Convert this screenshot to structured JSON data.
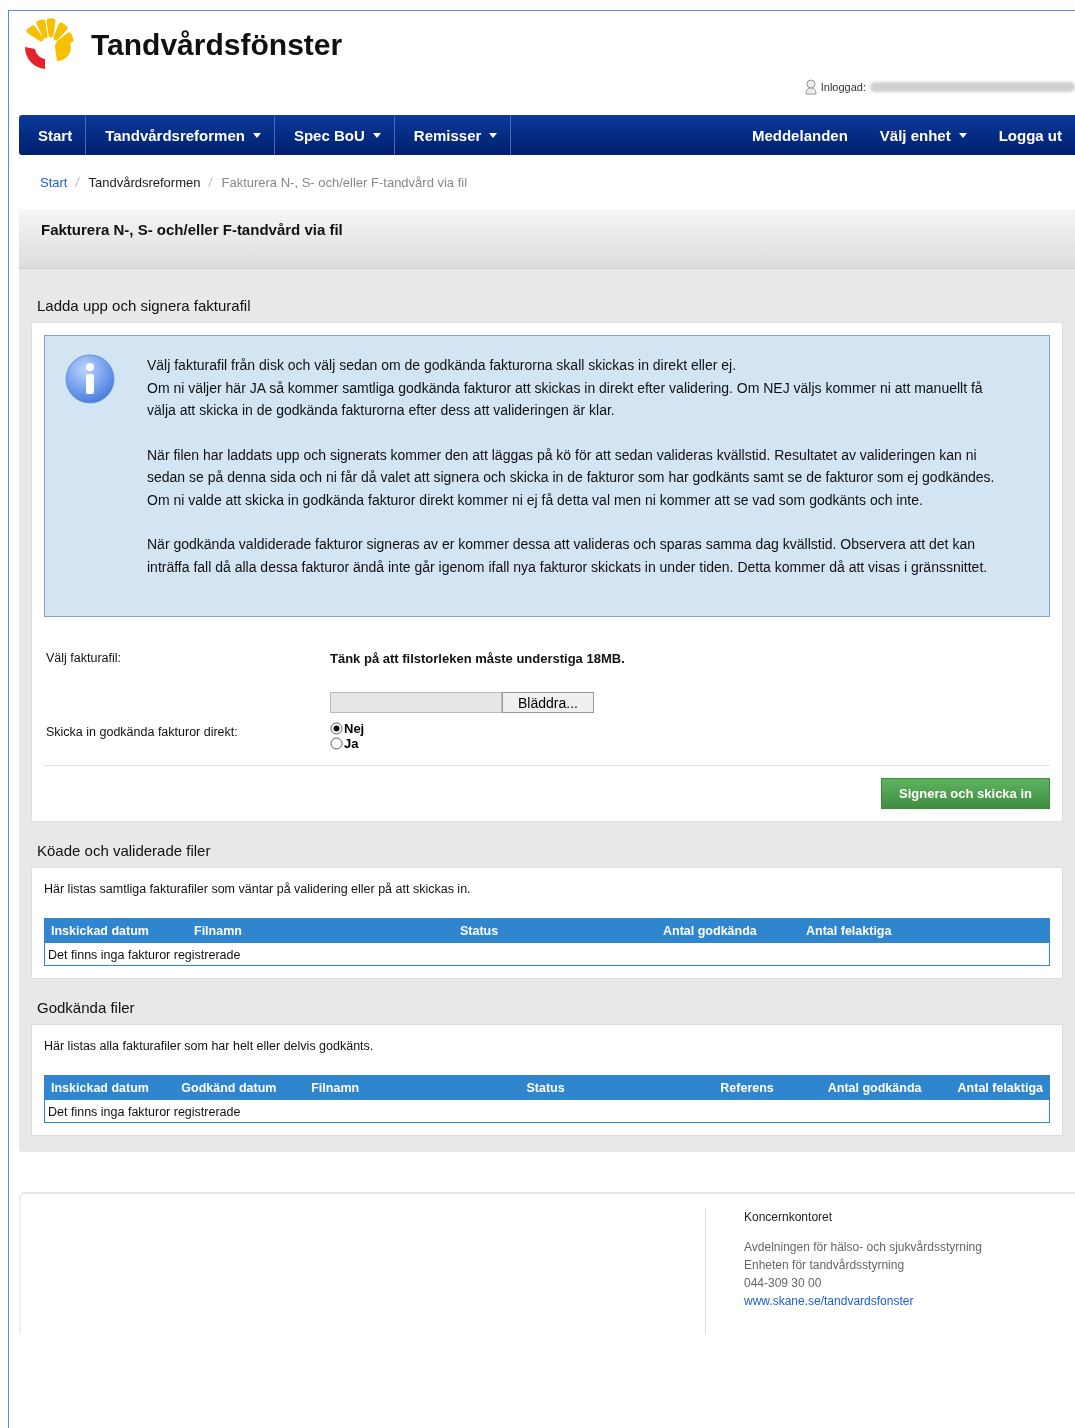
{
  "header": {
    "title": "Tandvårdsfönster",
    "logged_in_label": "Inloggad:"
  },
  "nav": {
    "left": [
      {
        "label": "Start",
        "dropdown": false
      },
      {
        "label": "Tandvårdsreformen",
        "dropdown": true
      },
      {
        "label": "Spec BoU",
        "dropdown": true
      },
      {
        "label": "Remisser",
        "dropdown": true
      }
    ],
    "right": [
      {
        "label": "Meddelanden",
        "dropdown": false
      },
      {
        "label": "Välj enhet",
        "dropdown": true
      },
      {
        "label": "Logga ut",
        "dropdown": false
      }
    ]
  },
  "breadcrumb": [
    {
      "label": "Start",
      "kind": "link"
    },
    {
      "label": "Tandvårdsreformen",
      "kind": "item"
    },
    {
      "label": "Fakturera N-, S- och/eller F-tandvård via fil",
      "kind": "current"
    }
  ],
  "page_title": "Fakturera N-, S- och/eller F-tandvård via fil",
  "upload": {
    "heading": "Ladda upp och signera fakturafil",
    "info": [
      "Välj fakturafil från disk och välj sedan om de godkända fakturorna skall skickas in direkt eller ej.\nOm ni väljer här JA så kommer samtliga godkända fakturor att skickas in direkt efter validering. Om NEJ väljs kommer ni att manuellt få välja att skicka in de godkända fakturorna efter dess att valideringen är klar.",
      "När filen har laddats upp och signerats kommer den att läggas på kö för att sedan valideras kvällstid. Resultatet av valideringen kan ni sedan se på denna sida och ni får då valet att signera och skicka in de fakturor som har godkänts samt se de fakturor som ej godkändes. Om ni valde att skicka in godkända fakturor direkt kommer ni ej få detta val men ni kommer att se vad som godkänts och inte.",
      "När godkända valdiderade fakturor signeras av er kommer dessa att valideras och sparas samma dag kvällstid. Observera att det kan inträffa fall då alla dessa fakturor ändå inte går igenom ifall nya fakturor skickats in under tiden. Detta kommer då att visas i gränssnittet."
    ],
    "file_label": "Välj fakturafil:",
    "file_note": "Tänk på att filstorleken måste understiga 18MB.",
    "browse_button": "Bläddra...",
    "direct_label": "Skicka in godkända fakturor direkt:",
    "options": [
      {
        "label": "Nej",
        "selected": true
      },
      {
        "label": "Ja",
        "selected": false
      }
    ],
    "submit_button": "Signera och skicka in"
  },
  "queued": {
    "heading": "Köade och validerade filer",
    "description": "Här listas samtliga fakturafiler som väntar på validering eller på att skickas in.",
    "columns": [
      "Inskickad datum",
      "Filnamn",
      "Status",
      "Antal godkända",
      "Antal felaktiga"
    ],
    "empty": "Det finns inga fakturor registrerade"
  },
  "approved": {
    "heading": "Godkända filer",
    "description": "Här listas alla fakturafiler som har helt eller delvis godkänts.",
    "columns": [
      "Inskickad datum",
      "Godkänd datum",
      "Filnamn",
      "Status",
      "Referens",
      "Antal godkända",
      "Antal felaktiga"
    ],
    "empty": "Det finns inga fakturor registrerade"
  },
  "footer": {
    "org": "Koncernkontoret",
    "lines": [
      "Avdelningen för hälso- och sjukvårdsstyrning",
      "Enheten för tandvårdsstyrning",
      "044-309 30 00"
    ],
    "link": "www.skane.se/tandvardsfonster"
  }
}
